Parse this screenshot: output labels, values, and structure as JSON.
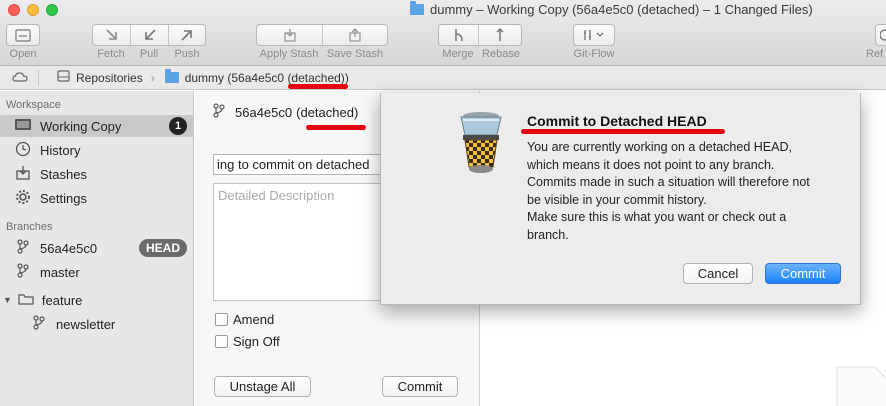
{
  "window": {
    "title": "dummy – Working Copy (56a4e5c0 (detached) – 1 Changed Files)"
  },
  "toolbar": {
    "open": "Open",
    "fetch": "Fetch",
    "pull": "Pull",
    "push": "Push",
    "apply_stash": "Apply Stash",
    "save_stash": "Save Stash",
    "merge": "Merge",
    "rebase": "Rebase",
    "git_flow": "Git-Flow",
    "refresh_partial": "Ref"
  },
  "pathbar": {
    "repositories": "Repositories",
    "repo_prefix": "dummy (56a4e5c0 ",
    "repo_detached": "(detached)",
    "repo_suffix": ")"
  },
  "sidebar": {
    "workspace_header": "Workspace",
    "workspace_items": [
      {
        "label": "Working Copy",
        "badge": "1"
      },
      {
        "label": "History"
      },
      {
        "label": "Stashes"
      },
      {
        "label": "Settings"
      }
    ],
    "branches_header": "Branches",
    "branches": [
      {
        "label": "56a4e5c0",
        "badge": "HEAD"
      },
      {
        "label": "master"
      }
    ],
    "folder": {
      "label": "feature",
      "children": [
        {
          "label": "newsletter"
        }
      ]
    }
  },
  "commit_pane": {
    "head_prefix": "56a4e5c0 ",
    "head_detached": "(detached)",
    "summary_value": "ing to commit on detached",
    "description_placeholder": "Detailed Description",
    "amend_label": "Amend",
    "signoff_label": "Sign Off",
    "unstage_all_label": "Unstage All",
    "commit_label": "Commit"
  },
  "dialog": {
    "title": "Commit to Detached HEAD",
    "message_lines": [
      "You are currently working on a detached HEAD,",
      "which means it does not point to any branch.",
      "Commits made in such a situation will therefore not",
      "be visible in your commit history.",
      "Make sure this is what you want or check out a",
      "branch."
    ],
    "cancel_label": "Cancel",
    "commit_label": "Commit"
  },
  "colors": {
    "accent_blue": "#1a82fb",
    "annotation_red": "#e4000f",
    "selection_gray": "#c9c9c9"
  }
}
